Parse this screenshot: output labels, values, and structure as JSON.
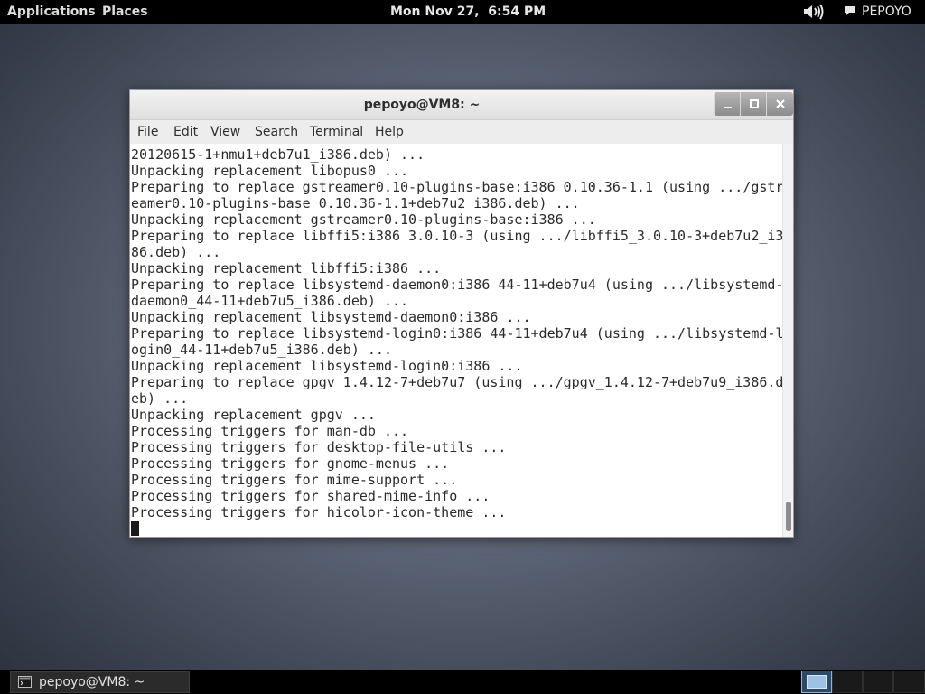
{
  "top_panel": {
    "applications_label": "Applications",
    "places_label": "Places",
    "clock": "Mon Nov 27,  6:54 PM",
    "user_label": "PEPOYO"
  },
  "window": {
    "title": "pepoyo@VM8: ~",
    "menu": [
      "File",
      "Edit",
      "View",
      "Search",
      "Terminal",
      "Help"
    ]
  },
  "terminal": {
    "lines": [
      "20120615-1+nmu1+deb7u1_i386.deb) ...",
      "Unpacking replacement libopus0 ...",
      "Preparing to replace gstreamer0.10-plugins-base:i386 0.10.36-1.1 (using .../gstr",
      "eamer0.10-plugins-base_0.10.36-1.1+deb7u2_i386.deb) ...",
      "Unpacking replacement gstreamer0.10-plugins-base:i386 ...",
      "Preparing to replace libffi5:i386 3.0.10-3 (using .../libffi5_3.0.10-3+deb7u2_i3",
      "86.deb) ...",
      "Unpacking replacement libffi5:i386 ...",
      "Preparing to replace libsystemd-daemon0:i386 44-11+deb7u4 (using .../libsystemd-",
      "daemon0_44-11+deb7u5_i386.deb) ...",
      "Unpacking replacement libsystemd-daemon0:i386 ...",
      "Preparing to replace libsystemd-login0:i386 44-11+deb7u4 (using .../libsystemd-l",
      "ogin0_44-11+deb7u5_i386.deb) ...",
      "Unpacking replacement libsystemd-login0:i386 ...",
      "Preparing to replace gpgv 1.4.12-7+deb7u7 (using .../gpgv_1.4.12-7+deb7u9_i386.d",
      "eb) ...",
      "Unpacking replacement gpgv ...",
      "Processing triggers for man-db ...",
      "Processing triggers for desktop-file-utils ...",
      "Processing triggers for gnome-menus ...",
      "Processing triggers for mime-support ...",
      "Processing triggers for shared-mime-info ...",
      "Processing triggers for hicolor-icon-theme ..."
    ]
  },
  "bottom_panel": {
    "task_label": "pepoyo@VM8: ~",
    "active_workspace": 1
  },
  "icons": {
    "volume": "volume-icon",
    "chat": "chat-icon",
    "terminal": "terminal-icon",
    "minimize": "minimize-icon",
    "maximize": "maximize-icon",
    "close": "close-icon"
  },
  "colors": {
    "panel": "#000000",
    "terminal_bg": "#ffffff",
    "terminal_fg": "#2b2b2b",
    "workspace_active": "#8fb4d8"
  }
}
